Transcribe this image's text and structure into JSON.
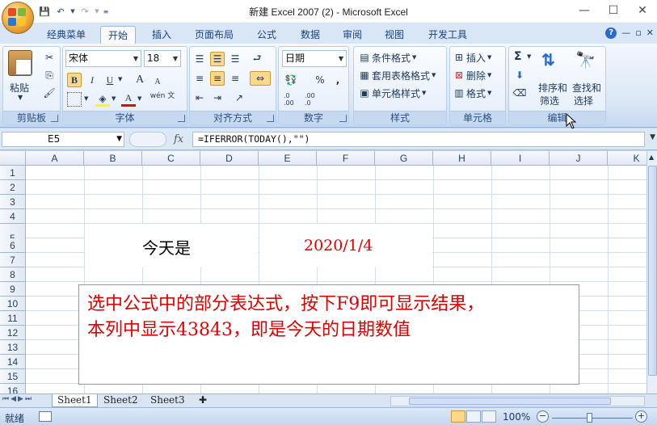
{
  "window": {
    "title": "新建 Excel 2007 (2) - Microsoft Excel",
    "min": "—",
    "max": "☐",
    "close": "✕"
  },
  "tabs": [
    {
      "label": "经典菜单",
      "active": false
    },
    {
      "label": "开始",
      "active": true
    },
    {
      "label": "插入",
      "active": false
    },
    {
      "label": "页面布局",
      "active": false
    },
    {
      "label": "公式",
      "active": false
    },
    {
      "label": "数据",
      "active": false
    },
    {
      "label": "审阅",
      "active": false
    },
    {
      "label": "视图",
      "active": false
    },
    {
      "label": "开发工具",
      "active": false
    }
  ],
  "ribbon": {
    "clipboard": {
      "label": "剪贴板",
      "paste": "粘贴"
    },
    "font": {
      "label": "字体",
      "name": "宋体",
      "size": "18",
      "bold": "B",
      "italic": "I",
      "underline": "U",
      "grow": "A",
      "shrink": "A",
      "font_color": "A",
      "phonetic": "wén 文"
    },
    "alignment": {
      "label": "对齐方式"
    },
    "number": {
      "label": "数字",
      "format": "日期",
      "percent": "%",
      "comma": ",",
      "inc": ".0 .00",
      "dec": ".00 .0"
    },
    "styles": {
      "label": "样式",
      "conditional": "条件格式",
      "table": "套用表格格式",
      "cell_styles": "单元格样式"
    },
    "cells": {
      "label": "单元格",
      "insert": "插入",
      "delete": "删除",
      "format": "格式"
    },
    "editing": {
      "label": "编辑",
      "sum": "Σ",
      "sort": "排序和",
      "sort2": "筛选",
      "find": "查找和",
      "find2": "选择"
    }
  },
  "formula_bar": {
    "name_box": "E5",
    "fx": "fx",
    "formula": "=IFERROR(TODAY(),\"\")"
  },
  "grid": {
    "columns": [
      "A",
      "B",
      "C",
      "D",
      "E",
      "F",
      "G",
      "H",
      "I",
      "J",
      "K"
    ],
    "rows": [
      "1",
      "2",
      "3",
      "4",
      "5",
      "6",
      "7",
      "8",
      "9",
      "10",
      "11",
      "12",
      "13",
      "14",
      "15",
      "16"
    ],
    "label_cell": "今天是",
    "date_cell": "2020/1/4"
  },
  "callout": {
    "line1": "选中公式中的部分表达式，按下F9即可显示结果，",
    "line2": "本列中显示43843，即是今天的日期数值"
  },
  "sheets": [
    {
      "name": "Sheet1",
      "active": true
    },
    {
      "name": "Sheet2",
      "active": false
    },
    {
      "name": "Sheet3",
      "active": false
    }
  ],
  "status": {
    "ready": "就绪",
    "zoom": "100%",
    "minus": "−",
    "plus": "+"
  }
}
